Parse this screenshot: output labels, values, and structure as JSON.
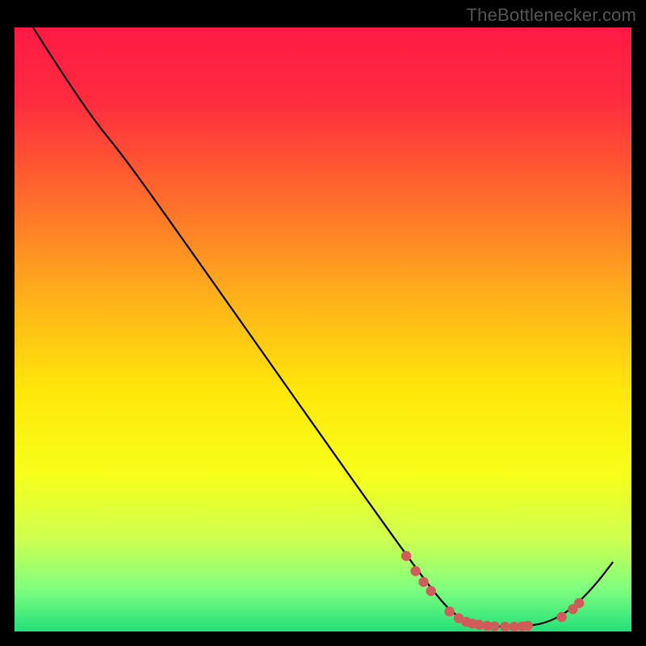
{
  "watermark": "TheBottlenecker.com",
  "chart_data": {
    "type": "line",
    "title": "",
    "xlabel": "",
    "ylabel": "",
    "xlim": [
      0,
      100
    ],
    "ylim": [
      0,
      100
    ],
    "grid": false,
    "legend": false,
    "background_gradient": {
      "stops": [
        {
          "offset": 0.0,
          "color": "#ff1a44"
        },
        {
          "offset": 0.12,
          "color": "#ff2b3f"
        },
        {
          "offset": 0.28,
          "color": "#ff6a2c"
        },
        {
          "offset": 0.45,
          "color": "#ffb21a"
        },
        {
          "offset": 0.6,
          "color": "#ffe609"
        },
        {
          "offset": 0.74,
          "color": "#f7ff1a"
        },
        {
          "offset": 0.85,
          "color": "#ccff52"
        },
        {
          "offset": 0.93,
          "color": "#7fff7f"
        },
        {
          "offset": 1.0,
          "color": "#22e07a"
        }
      ]
    },
    "series": [
      {
        "name": "curve",
        "color": "#000000",
        "type": "line",
        "points": [
          {
            "x": 3.0,
            "y": 100.0
          },
          {
            "x": 8.0,
            "y": 92.0
          },
          {
            "x": 13.0,
            "y": 84.5
          },
          {
            "x": 17.0,
            "y": 79.5
          },
          {
            "x": 22.0,
            "y": 72.5
          },
          {
            "x": 30.0,
            "y": 61.0
          },
          {
            "x": 40.0,
            "y": 46.5
          },
          {
            "x": 50.0,
            "y": 32.0
          },
          {
            "x": 58.0,
            "y": 20.5
          },
          {
            "x": 64.0,
            "y": 12.0
          },
          {
            "x": 68.0,
            "y": 6.5
          },
          {
            "x": 71.0,
            "y": 3.0
          },
          {
            "x": 74.0,
            "y": 1.3
          },
          {
            "x": 78.0,
            "y": 0.8
          },
          {
            "x": 82.0,
            "y": 0.8
          },
          {
            "x": 86.0,
            "y": 1.3
          },
          {
            "x": 90.0,
            "y": 3.4
          },
          {
            "x": 94.0,
            "y": 7.5
          },
          {
            "x": 97.0,
            "y": 11.5
          }
        ]
      },
      {
        "name": "markers",
        "color": "#d15a5a",
        "type": "scatter",
        "points": [
          {
            "x": 63.5,
            "y": 12.5
          },
          {
            "x": 65.0,
            "y": 10.0
          },
          {
            "x": 66.3,
            "y": 8.2
          },
          {
            "x": 67.5,
            "y": 6.7
          },
          {
            "x": 70.5,
            "y": 3.3
          },
          {
            "x": 72.0,
            "y": 2.2
          },
          {
            "x": 73.2,
            "y": 1.6
          },
          {
            "x": 74.2,
            "y": 1.3
          },
          {
            "x": 75.3,
            "y": 1.1
          },
          {
            "x": 76.6,
            "y": 0.95
          },
          {
            "x": 77.8,
            "y": 0.85
          },
          {
            "x": 79.5,
            "y": 0.8
          },
          {
            "x": 81.0,
            "y": 0.8
          },
          {
            "x": 82.3,
            "y": 0.85
          },
          {
            "x": 83.2,
            "y": 0.95
          },
          {
            "x": 88.7,
            "y": 2.4
          },
          {
            "x": 90.5,
            "y": 3.7
          },
          {
            "x": 91.5,
            "y": 4.7
          }
        ]
      }
    ]
  }
}
